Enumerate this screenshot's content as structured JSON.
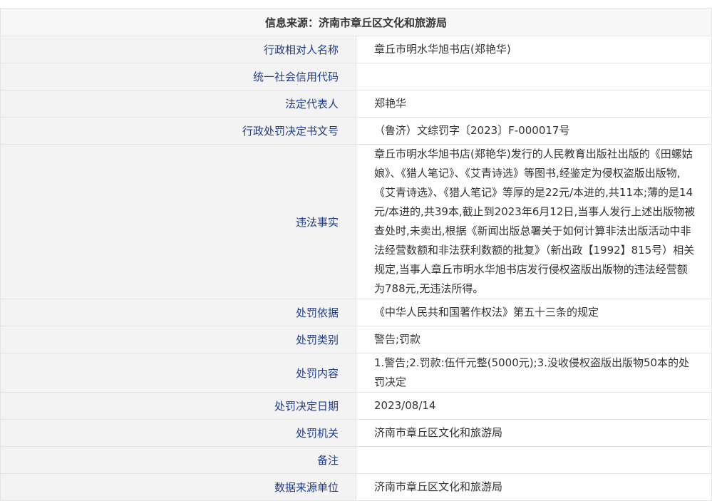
{
  "source": {
    "label": "信息来源：",
    "value": "济南市章丘区文化和旅游局"
  },
  "rows": [
    {
      "label": "行政相对人名称",
      "value": "章丘市明水华旭书店(郑艳华)"
    },
    {
      "label": "统一社会信用代码",
      "value": ""
    },
    {
      "label": "法定代表人",
      "value": "郑艳华"
    },
    {
      "label": "行政处罚决定书文号",
      "value": "（鲁济）文综罚字〔2023〕F-000017号"
    },
    {
      "label": "违法事实",
      "value": "章丘市明水华旭书店(郑艳华)发行的人民教育出版社出版的《田螺姑娘》、《猎人笔记》、《艾青诗选》等图书,经鉴定为侵权盗版出版物,《艾青诗选》、《猎人笔记》等厚的是22元/本进的,共11本;薄的是14元/本进的,共39本,截止到2023年6月12日,当事人发行上述出版物被查处时,未卖出,根据《新闻出版总署关于如何计算非法出版活动中非法经营数额和非法获利数额的批复》（新出政【1992】815号）相关规定,当事人章丘市明水华旭书店发行侵权盗版出版物的违法经营额为788元,无违法所得。"
    },
    {
      "label": "处罚依据",
      "value": "《中华人民共和国著作权法》第五十三条的规定"
    },
    {
      "label": "处罚类别",
      "value": "警告;罚款"
    },
    {
      "label": "处罚内容",
      "value": "1.警告;2.罚款:伍仟元整(5000元);3.没收侵权盗版出版物50本的处罚决定"
    },
    {
      "label": "处罚决定日期",
      "value": "2023/08/14"
    },
    {
      "label": "处罚机关",
      "value": "济南市章丘区文化和旅游局"
    },
    {
      "label": "备注",
      "value": ""
    },
    {
      "label": "数据来源单位",
      "value": "济南市章丘区文化和旅游局"
    }
  ]
}
